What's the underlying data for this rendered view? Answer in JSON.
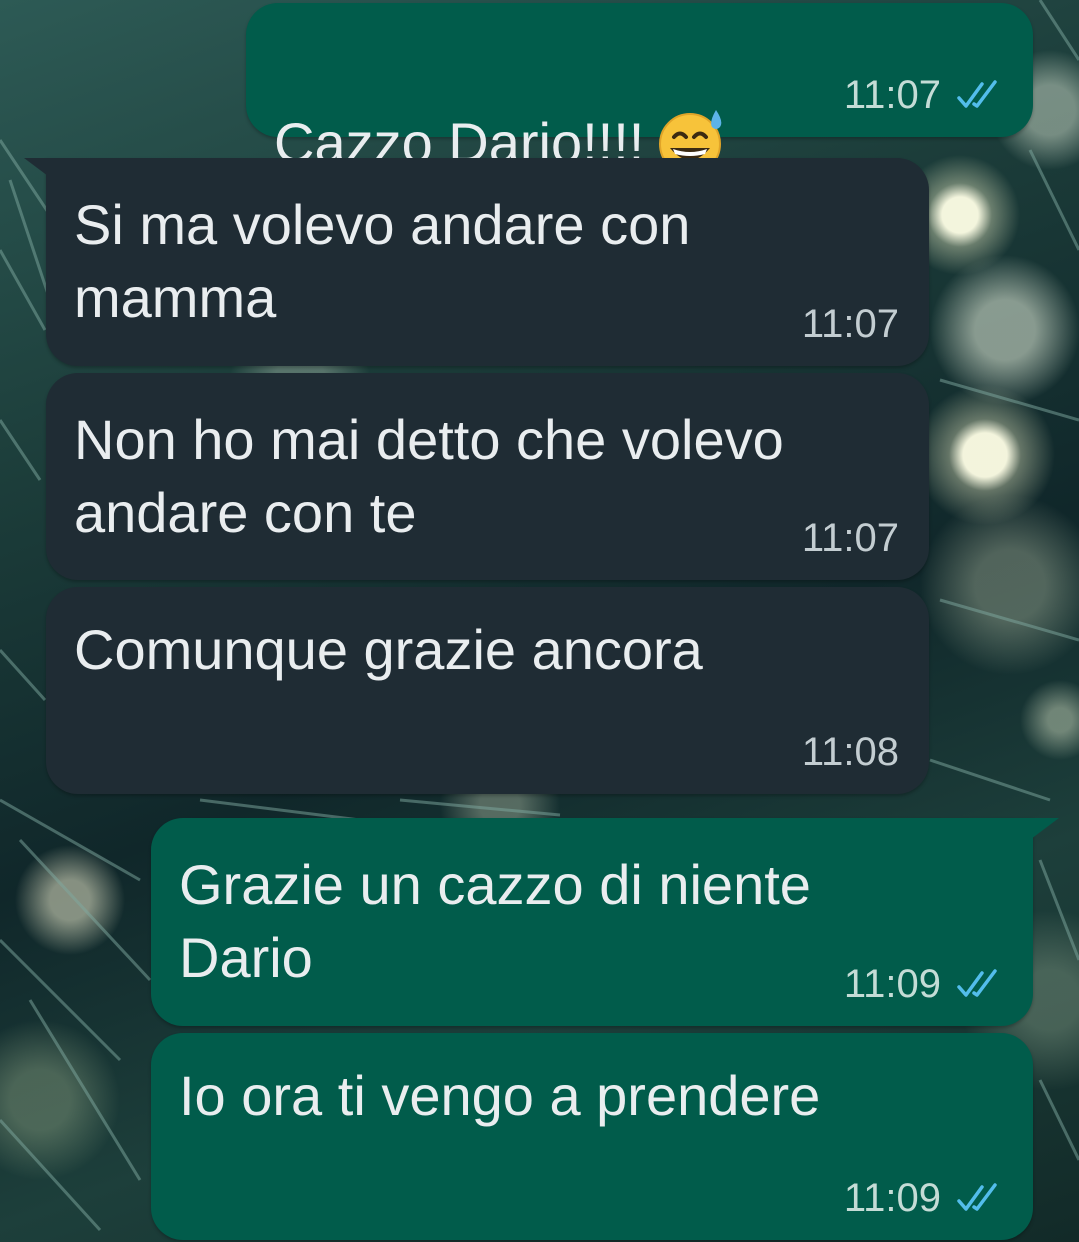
{
  "colors": {
    "outgoing_bubble": "#015c4b",
    "incoming_bubble": "#1f2c34",
    "message_text": "#e9edef",
    "read_ticks": "#53bdeb"
  },
  "messages": [
    {
      "direction": "outgoing",
      "text": "Cazzo Dario!!!!",
      "emoji": "grinning-face-with-sweat",
      "time": "11:07",
      "status": "read"
    },
    {
      "direction": "incoming",
      "text": "Si ma volevo andare con\nmamma",
      "time": "11:07"
    },
    {
      "direction": "incoming",
      "text": "Non ho mai detto che volevo\nandare con te",
      "time": "11:07"
    },
    {
      "direction": "incoming",
      "text": "Comunque grazie ancora",
      "time": "11:08"
    },
    {
      "direction": "outgoing",
      "text": "Grazie un cazzo di niente\nDario",
      "time": "11:09",
      "status": "read"
    },
    {
      "direction": "outgoing",
      "text": "Io ora ti vengo a prendere",
      "time": "11:09",
      "status": "read"
    }
  ]
}
